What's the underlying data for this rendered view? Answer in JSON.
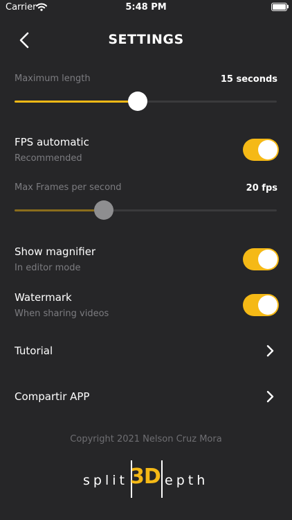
{
  "status_bar": {
    "carrier": "Carrier",
    "time": "5:48 PM"
  },
  "header": {
    "title": "SETTINGS"
  },
  "max_length": {
    "label": "Maximum length",
    "value": "15 seconds",
    "level": 0.47
  },
  "fps_automatic": {
    "label": "FPS automatic",
    "sublabel": "Recommended",
    "on": true
  },
  "max_fps": {
    "label": "Max Frames per second",
    "value": "20 fps",
    "level": 0.34
  },
  "show_magnifier": {
    "label": "Show magnifier",
    "sublabel": "In editor mode",
    "on": true
  },
  "watermark": {
    "label": "Watermark",
    "sublabel": "When sharing videos",
    "on": true
  },
  "tutorial": {
    "label": "Tutorial"
  },
  "share_app": {
    "label": "Compartir APP"
  },
  "footer": {
    "copyright": "Copyright 2021 Nelson Cruz Mora"
  },
  "logo": {
    "split": "split",
    "three_d": "3D",
    "depth": "epth"
  },
  "colors": {
    "accent": "#f5b916",
    "accent_dim": "#8a6d1c",
    "background": "#262628",
    "disabled_thumb": "#8e8e90"
  }
}
